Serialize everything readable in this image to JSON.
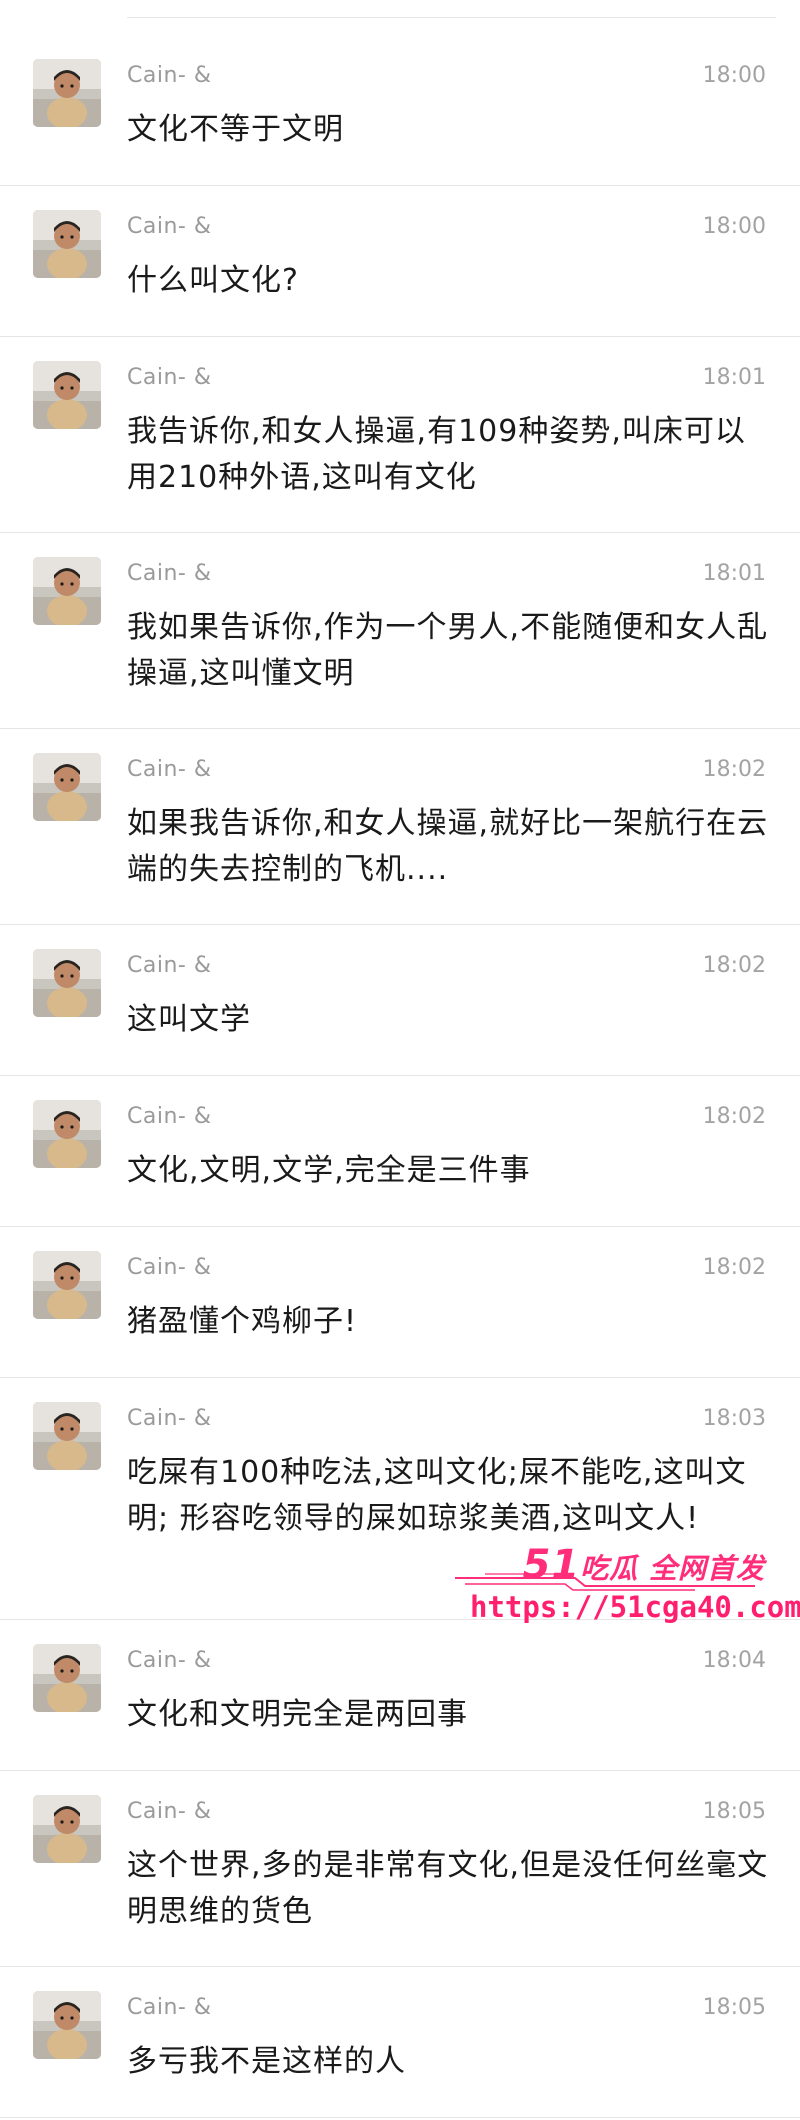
{
  "messages": [
    {
      "sender": "Cain- &",
      "time": "18:00",
      "text": "文化不等于文明"
    },
    {
      "sender": "Cain- &",
      "time": "18:00",
      "text": "什么叫文化?"
    },
    {
      "sender": "Cain- &",
      "time": "18:01",
      "text": "我告诉你,和女人操逼,有109种姿势,叫床可以用210种外语,这叫有文化"
    },
    {
      "sender": "Cain- &",
      "time": "18:01",
      "text": "我如果告诉你,作为一个男人,不能随便和女人乱操逼,这叫懂文明"
    },
    {
      "sender": "Cain- &",
      "time": "18:02",
      "text": "如果我告诉你,和女人操逼,就好比一架航行在云端的失去控制的飞机...."
    },
    {
      "sender": "Cain- &",
      "time": "18:02",
      "text": "这叫文学"
    },
    {
      "sender": "Cain- &",
      "time": "18:02",
      "text": "文化,文明,文学,完全是三件事"
    },
    {
      "sender": "Cain- &",
      "time": "18:02",
      "text": "猪盈懂个鸡柳子!"
    },
    {
      "sender": "Cain- &",
      "time": "18:03",
      "text": "吃屎有100种吃法,这叫文化;屎不能吃,这叫文明; 形容吃领导的屎如琼浆美酒,这叫文人!"
    },
    {
      "sender": "Cain- &",
      "time": "18:04",
      "text": "文化和文明完全是两回事"
    },
    {
      "sender": "Cain- &",
      "time": "18:05",
      "text": "这个世界,多的是非常有文化,但是没任何丝毫文明思维的货色"
    },
    {
      "sender": "Cain- &",
      "time": "18:05",
      "text": "多亏我不是这样的人"
    }
  ],
  "watermark": {
    "brand_number": "51",
    "brand_text": "吃瓜 全网首发",
    "url": "https://51cga40.com",
    "color": "#ff2d7a"
  }
}
